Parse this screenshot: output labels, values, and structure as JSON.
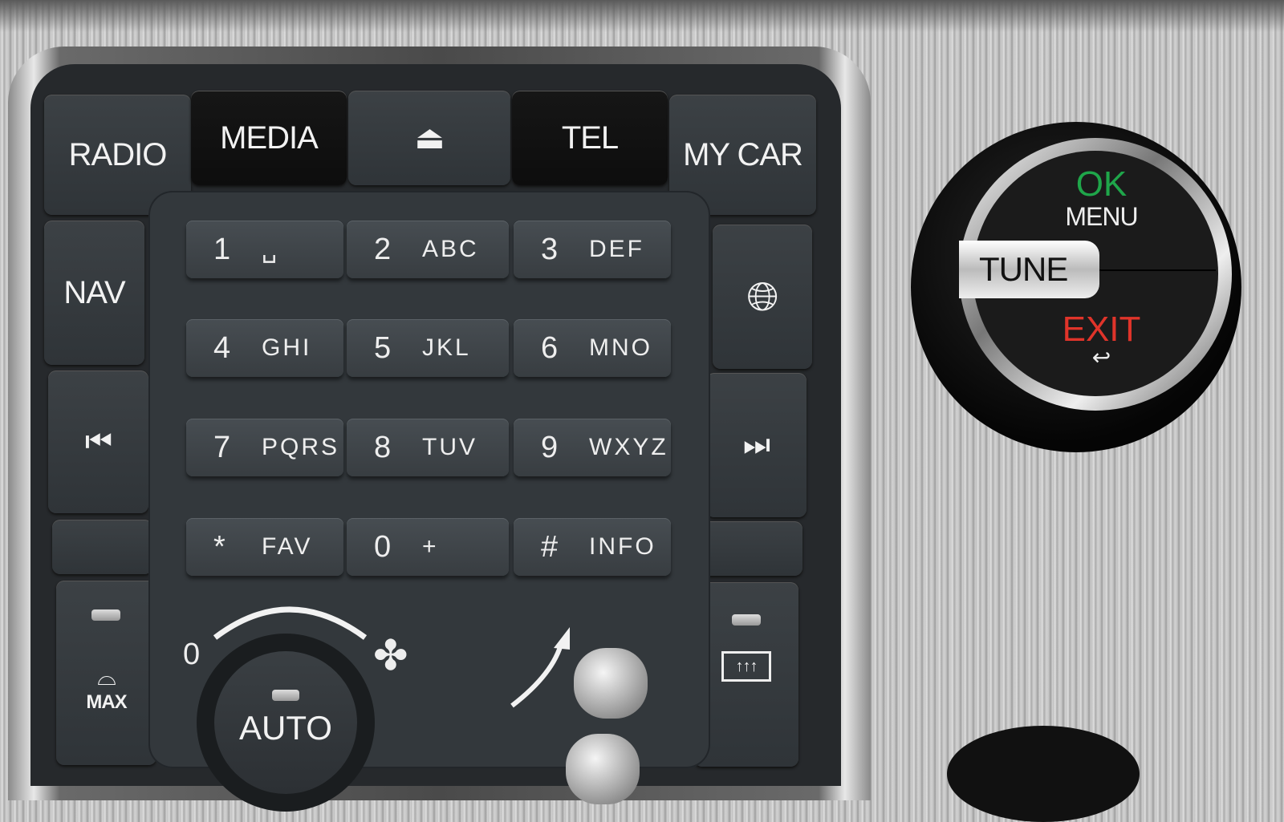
{
  "top_row": {
    "radio": "RADIO",
    "media": "MEDIA",
    "eject_icon": "eject-icon",
    "tel": "TEL",
    "my_car": "MY CAR"
  },
  "side": {
    "nav": "NAV",
    "globe_icon": "globe-icon",
    "prev_icon": "skip-previous-icon",
    "next_icon": "skip-next-icon"
  },
  "keypad": [
    {
      "num": "1",
      "letters": "␣"
    },
    {
      "num": "2",
      "letters": "ABC"
    },
    {
      "num": "3",
      "letters": "DEF"
    },
    {
      "num": "4",
      "letters": "GHI"
    },
    {
      "num": "5",
      "letters": "JKL"
    },
    {
      "num": "6",
      "letters": "MNO"
    },
    {
      "num": "7",
      "letters": "PQRS"
    },
    {
      "num": "8",
      "letters": "TUV"
    },
    {
      "num": "9",
      "letters": "WXYZ"
    },
    {
      "num": "*",
      "letters": "FAV"
    },
    {
      "num": "0",
      "letters": "+"
    },
    {
      "num": "#",
      "letters": "INFO"
    }
  ],
  "climate": {
    "max_defrost": "MAX",
    "fan_zero": "0",
    "auto": "AUTO",
    "fan_icon": "fan-icon",
    "rear_defrost_icon": "rear-defrost-icon"
  },
  "knob": {
    "ok": "OK",
    "menu": "MENU",
    "tune": "TUNE",
    "exit": "EXIT",
    "ok_color": "#1fa64a",
    "exit_color": "#e0342a",
    "back_icon": "back-arrow-icon"
  }
}
